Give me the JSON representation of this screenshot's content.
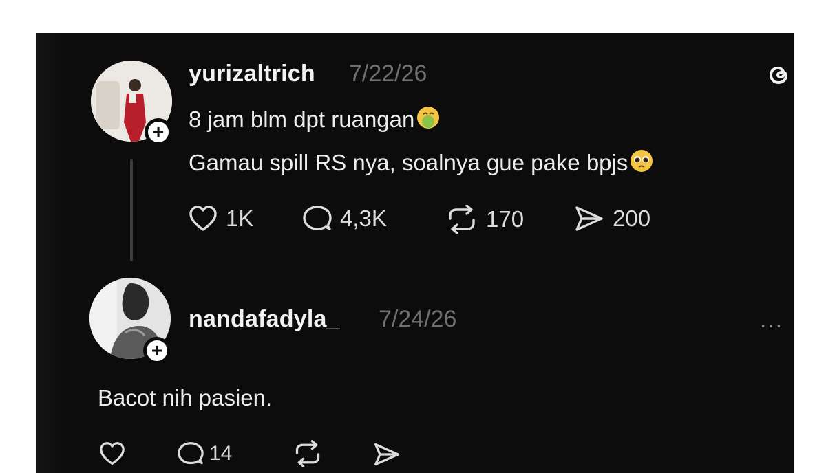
{
  "post": {
    "username": "yurizaltrich",
    "date": "7/22/26",
    "line1": "8 jam blm dpt ruangan",
    "line1_emoji": "nauseated-face",
    "line2": "Gamau spill RS nya, soalnya gue pake bpjs",
    "line2_emoji": "pleading-face",
    "actions": {
      "likes": "1K",
      "replies": "4,3K",
      "reposts": "170",
      "shares": "200"
    }
  },
  "reply": {
    "username": "nandafadyla_",
    "date": "7/24/26",
    "text": "Bacot nih pasien.",
    "actions": {
      "replies": "14"
    }
  },
  "theme": {
    "background": "#0c0c0c",
    "text": "#ededed",
    "muted": "#6f6f6f"
  }
}
